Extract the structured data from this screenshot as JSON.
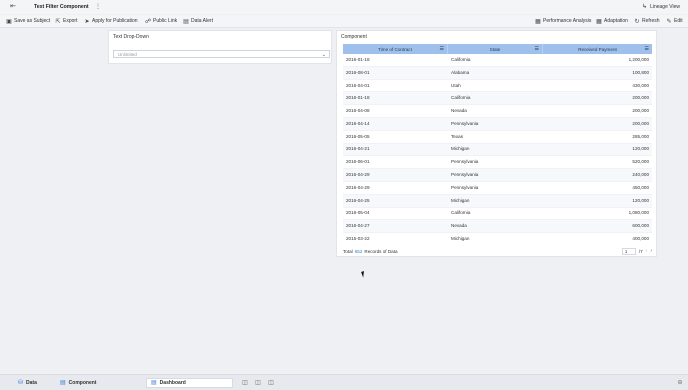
{
  "topbar": {
    "back_icon": "arrow-left-icon",
    "title": "Text Filter Component",
    "more_icon": "vertical-ellipsis-icon",
    "lineage_label": "Lineage View"
  },
  "toolbar": {
    "left": [
      {
        "icon": "save-icon",
        "label": "Save as Subject"
      },
      {
        "icon": "export-icon",
        "label": "Export"
      },
      {
        "icon": "send-icon",
        "label": "Apply for Publication"
      },
      {
        "icon": "link-icon",
        "label": "Public Link"
      },
      {
        "icon": "alert-icon",
        "label": "Data Alert"
      }
    ],
    "right": [
      {
        "icon": "performance-icon",
        "label": "Performance Analysis"
      },
      {
        "icon": "adaptation-icon",
        "label": "Adaptation"
      },
      {
        "icon": "refresh-icon",
        "label": "Refresh"
      },
      {
        "icon": "edit-icon",
        "label": "Edit"
      }
    ]
  },
  "filter_panel": {
    "title": "Text Drop-Down",
    "placeholder": "Unlimited"
  },
  "table_panel": {
    "title": "Component",
    "columns": [
      "Time of Contract",
      "State",
      "Received Payment"
    ],
    "rows": [
      [
        "2016-01-18",
        "California",
        "1,200,000"
      ],
      [
        "2016-08-01",
        "Alabama",
        "100,800"
      ],
      [
        "2016-04-01",
        "Utah",
        "430,000"
      ],
      [
        "2016-01-18",
        "California",
        "200,000"
      ],
      [
        "2016-04-08",
        "Nevada",
        "200,000"
      ],
      [
        "2016-04-14",
        " Pennsylvania",
        "200,000"
      ],
      [
        "2016-05-05",
        "Texas",
        "285,000"
      ],
      [
        "2016-04-21",
        "Michigan",
        "120,000"
      ],
      [
        "2016-06-01",
        " Pennsylvania",
        "520,000"
      ],
      [
        "2016-04-29",
        " Pennsylvania",
        "240,000"
      ],
      [
        "2016-04-29",
        " Pennsylvania",
        "450,000"
      ],
      [
        "2016-04-25",
        "Michigan",
        "120,000"
      ],
      [
        "2016-05-04",
        "California",
        "1,080,000"
      ],
      [
        "2016-04-27",
        "Nevada",
        "600,000"
      ],
      [
        "2015-03-22",
        "Michigan",
        "400,000"
      ]
    ],
    "footer": {
      "total_label": "Total",
      "count": "652",
      "records_label": "Records of Data",
      "page": "1",
      "page_total": "/7"
    }
  },
  "bottombar": {
    "tabs": [
      {
        "icon": "database-icon",
        "label": "Data"
      },
      {
        "icon": "component-icon",
        "label": "Component"
      },
      {
        "icon": "dashboard-icon",
        "label": "Dashboard"
      }
    ]
  }
}
